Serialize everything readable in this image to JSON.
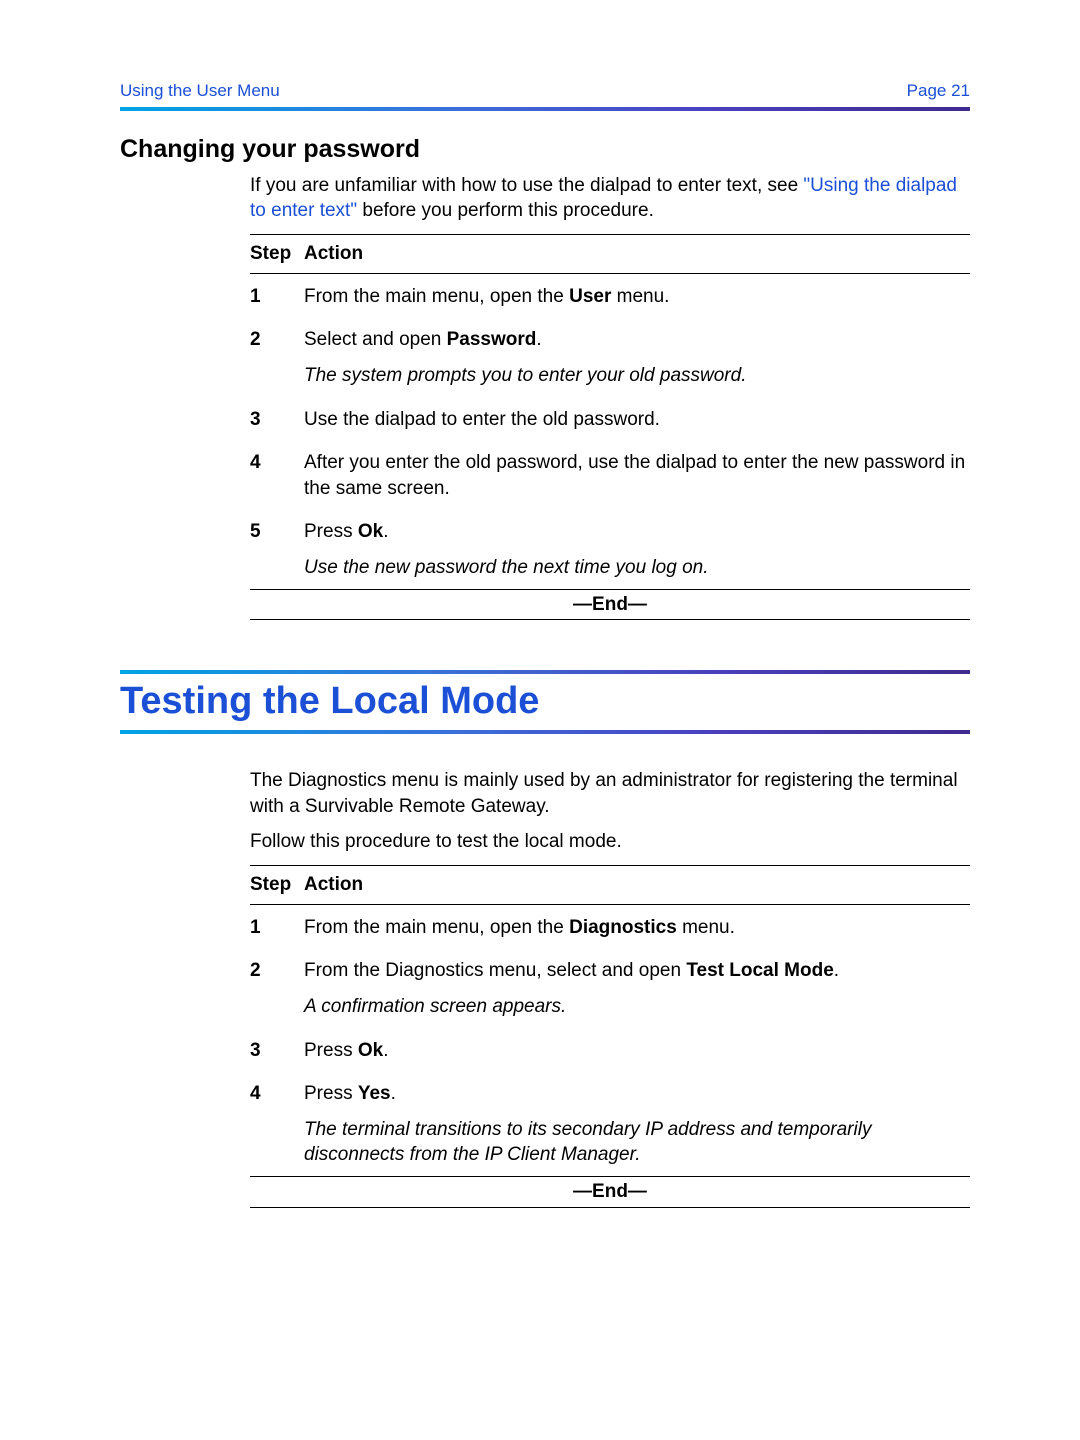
{
  "header": {
    "left": "Using the User Menu",
    "right": "Page 21"
  },
  "section1": {
    "heading": "Changing your password",
    "intro_pre": "If you are unfamiliar with how to use the dialpad to enter text, see ",
    "intro_link": "\"Using the dialpad to enter text\"",
    "intro_post": " before you perform this procedure.",
    "table_headers": {
      "step": "Step",
      "action": "Action"
    },
    "steps": [
      {
        "num": "1",
        "action_pre": "From the main menu, open the ",
        "action_bold": "User",
        "action_post": " menu."
      },
      {
        "num": "2",
        "action_pre": "Select and open ",
        "action_bold": "Password",
        "action_post": ".",
        "result": "The system prompts you to enter your old password."
      },
      {
        "num": "3",
        "action_pre": "Use the dialpad to enter the old password.",
        "action_bold": "",
        "action_post": ""
      },
      {
        "num": "4",
        "action_pre": "After you enter the old password, use the dialpad to enter the new password in the same screen.",
        "action_bold": "",
        "action_post": ""
      },
      {
        "num": "5",
        "action_pre": "Press ",
        "action_bold": "Ok",
        "action_post": ".",
        "result": "Use the new password the next time you log on."
      }
    ],
    "end": "—End—"
  },
  "chapter": {
    "title": "Testing the Local Mode"
  },
  "section2": {
    "intro1": "The Diagnostics menu is mainly used by an administrator for registering the terminal with a Survivable Remote Gateway.",
    "intro2": "Follow this procedure to test the local mode.",
    "table_headers": {
      "step": "Step",
      "action": "Action"
    },
    "steps": [
      {
        "num": "1",
        "action_pre": "From the main menu, open the ",
        "action_bold": "Diagnostics",
        "action_post": " menu."
      },
      {
        "num": "2",
        "action_pre": "From the Diagnostics menu, select and open ",
        "action_bold": "Test Local Mode",
        "action_post": ".",
        "result": "A confirmation screen appears."
      },
      {
        "num": "3",
        "action_pre": "Press ",
        "action_bold": "Ok",
        "action_post": "."
      },
      {
        "num": "4",
        "action_pre": "Press ",
        "action_bold": "Yes",
        "action_post": ".",
        "result": "The terminal transitions to its secondary IP address and temporarily disconnects from the IP Client Manager."
      }
    ],
    "end": "—End—"
  }
}
